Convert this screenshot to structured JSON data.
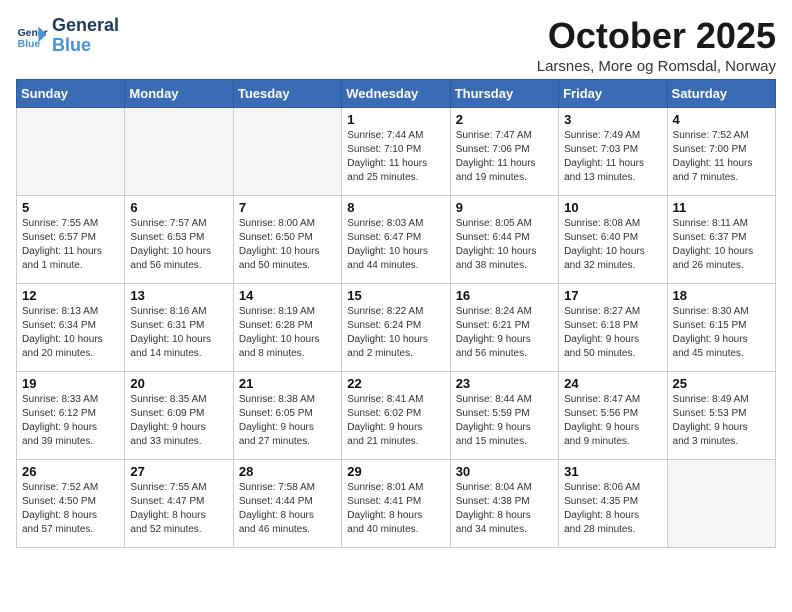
{
  "header": {
    "logo_line1": "General",
    "logo_line2": "Blue",
    "title": "October 2025",
    "subtitle": "Larsnes, More og Romsdal, Norway"
  },
  "weekdays": [
    "Sunday",
    "Monday",
    "Tuesday",
    "Wednesday",
    "Thursday",
    "Friday",
    "Saturday"
  ],
  "weeks": [
    {
      "days": [
        {
          "num": "",
          "info": ""
        },
        {
          "num": "",
          "info": ""
        },
        {
          "num": "",
          "info": ""
        },
        {
          "num": "1",
          "info": "Sunrise: 7:44 AM\nSunset: 7:10 PM\nDaylight: 11 hours\nand 25 minutes."
        },
        {
          "num": "2",
          "info": "Sunrise: 7:47 AM\nSunset: 7:06 PM\nDaylight: 11 hours\nand 19 minutes."
        },
        {
          "num": "3",
          "info": "Sunrise: 7:49 AM\nSunset: 7:03 PM\nDaylight: 11 hours\nand 13 minutes."
        },
        {
          "num": "4",
          "info": "Sunrise: 7:52 AM\nSunset: 7:00 PM\nDaylight: 11 hours\nand 7 minutes."
        }
      ]
    },
    {
      "days": [
        {
          "num": "5",
          "info": "Sunrise: 7:55 AM\nSunset: 6:57 PM\nDaylight: 11 hours\nand 1 minute."
        },
        {
          "num": "6",
          "info": "Sunrise: 7:57 AM\nSunset: 6:53 PM\nDaylight: 10 hours\nand 56 minutes."
        },
        {
          "num": "7",
          "info": "Sunrise: 8:00 AM\nSunset: 6:50 PM\nDaylight: 10 hours\nand 50 minutes."
        },
        {
          "num": "8",
          "info": "Sunrise: 8:03 AM\nSunset: 6:47 PM\nDaylight: 10 hours\nand 44 minutes."
        },
        {
          "num": "9",
          "info": "Sunrise: 8:05 AM\nSunset: 6:44 PM\nDaylight: 10 hours\nand 38 minutes."
        },
        {
          "num": "10",
          "info": "Sunrise: 8:08 AM\nSunset: 6:40 PM\nDaylight: 10 hours\nand 32 minutes."
        },
        {
          "num": "11",
          "info": "Sunrise: 8:11 AM\nSunset: 6:37 PM\nDaylight: 10 hours\nand 26 minutes."
        }
      ]
    },
    {
      "days": [
        {
          "num": "12",
          "info": "Sunrise: 8:13 AM\nSunset: 6:34 PM\nDaylight: 10 hours\nand 20 minutes."
        },
        {
          "num": "13",
          "info": "Sunrise: 8:16 AM\nSunset: 6:31 PM\nDaylight: 10 hours\nand 14 minutes."
        },
        {
          "num": "14",
          "info": "Sunrise: 8:19 AM\nSunset: 6:28 PM\nDaylight: 10 hours\nand 8 minutes."
        },
        {
          "num": "15",
          "info": "Sunrise: 8:22 AM\nSunset: 6:24 PM\nDaylight: 10 hours\nand 2 minutes."
        },
        {
          "num": "16",
          "info": "Sunrise: 8:24 AM\nSunset: 6:21 PM\nDaylight: 9 hours\nand 56 minutes."
        },
        {
          "num": "17",
          "info": "Sunrise: 8:27 AM\nSunset: 6:18 PM\nDaylight: 9 hours\nand 50 minutes."
        },
        {
          "num": "18",
          "info": "Sunrise: 8:30 AM\nSunset: 6:15 PM\nDaylight: 9 hours\nand 45 minutes."
        }
      ]
    },
    {
      "days": [
        {
          "num": "19",
          "info": "Sunrise: 8:33 AM\nSunset: 6:12 PM\nDaylight: 9 hours\nand 39 minutes."
        },
        {
          "num": "20",
          "info": "Sunrise: 8:35 AM\nSunset: 6:09 PM\nDaylight: 9 hours\nand 33 minutes."
        },
        {
          "num": "21",
          "info": "Sunrise: 8:38 AM\nSunset: 6:05 PM\nDaylight: 9 hours\nand 27 minutes."
        },
        {
          "num": "22",
          "info": "Sunrise: 8:41 AM\nSunset: 6:02 PM\nDaylight: 9 hours\nand 21 minutes."
        },
        {
          "num": "23",
          "info": "Sunrise: 8:44 AM\nSunset: 5:59 PM\nDaylight: 9 hours\nand 15 minutes."
        },
        {
          "num": "24",
          "info": "Sunrise: 8:47 AM\nSunset: 5:56 PM\nDaylight: 9 hours\nand 9 minutes."
        },
        {
          "num": "25",
          "info": "Sunrise: 8:49 AM\nSunset: 5:53 PM\nDaylight: 9 hours\nand 3 minutes."
        }
      ]
    },
    {
      "days": [
        {
          "num": "26",
          "info": "Sunrise: 7:52 AM\nSunset: 4:50 PM\nDaylight: 8 hours\nand 57 minutes."
        },
        {
          "num": "27",
          "info": "Sunrise: 7:55 AM\nSunset: 4:47 PM\nDaylight: 8 hours\nand 52 minutes."
        },
        {
          "num": "28",
          "info": "Sunrise: 7:58 AM\nSunset: 4:44 PM\nDaylight: 8 hours\nand 46 minutes."
        },
        {
          "num": "29",
          "info": "Sunrise: 8:01 AM\nSunset: 4:41 PM\nDaylight: 8 hours\nand 40 minutes."
        },
        {
          "num": "30",
          "info": "Sunrise: 8:04 AM\nSunset: 4:38 PM\nDaylight: 8 hours\nand 34 minutes."
        },
        {
          "num": "31",
          "info": "Sunrise: 8:06 AM\nSunset: 4:35 PM\nDaylight: 8 hours\nand 28 minutes."
        },
        {
          "num": "",
          "info": ""
        }
      ]
    }
  ]
}
